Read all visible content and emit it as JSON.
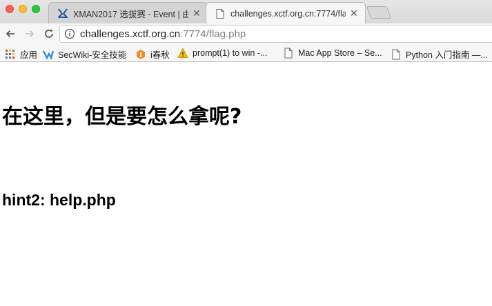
{
  "tabs": [
    {
      "title": "XMAN2017 选拔赛 - Event | 由",
      "close": "✕",
      "active": false
    },
    {
      "title": "challenges.xctf.org.cn:7774/fla",
      "close": "✕",
      "active": true
    }
  ],
  "address_bar": {
    "host": "challenges.xctf.org.cn",
    "path": ":7774/flag.php"
  },
  "bookmarks": [
    {
      "label": "应用",
      "icon": "apps-grid-icon"
    },
    {
      "label": "SecWiki-安全技能",
      "icon": "secwiki-icon"
    },
    {
      "label": "i春秋",
      "icon": "ichunqiu-icon"
    },
    {
      "label": "prompt(1) to win -...",
      "icon": "warning-icon"
    },
    {
      "label": "Mac App Store – Se...",
      "icon": "page-icon"
    },
    {
      "label": "Python 入门指南 —...",
      "icon": "page-icon"
    }
  ],
  "page": {
    "heading": "在这里，但是要怎么拿呢?",
    "hint": "hint2: help.php"
  },
  "colors": {
    "close_light": "#fc5f57",
    "minimize_light": "#fdbc2e",
    "maximize_light": "#28c840",
    "secwiki_blue": "#2f8fd8",
    "ichunqiu_orange": "#f08a1c",
    "warning_yellow": "#f2c200"
  }
}
